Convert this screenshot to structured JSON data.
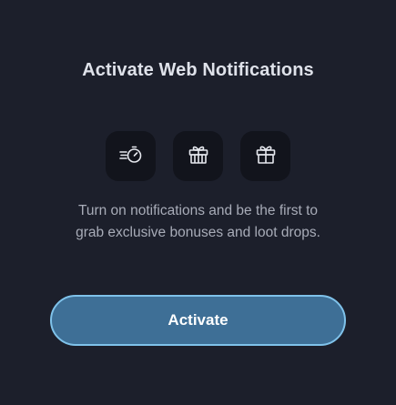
{
  "dialog": {
    "title": "Activate Web Notifications",
    "icons": [
      "fast-timer-icon",
      "gift-box-icon",
      "gift-icon"
    ],
    "description_line1": "Turn on notifications and be the first to",
    "description_line2": "grab exclusive bonuses and loot drops.",
    "activate_label": "Activate"
  },
  "colors": {
    "background": "#1c1f2b",
    "icon_tile": "#12141c",
    "button_fill": "#3e6f96",
    "button_border": "#7fc2ea"
  }
}
